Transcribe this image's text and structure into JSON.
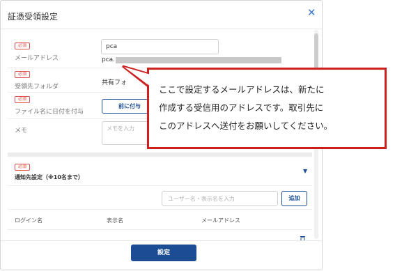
{
  "dialog": {
    "title": "証憑受領設定"
  },
  "email": {
    "required": "必須",
    "label": "メールアドレス",
    "value": "pca",
    "address_prefix": "pca."
  },
  "folder": {
    "required": "必須",
    "label": "受領先フォルダ",
    "value": "共有フォ"
  },
  "filename_date": {
    "required": "必須",
    "label": "ファイル名に日付を付与",
    "option": "前に付与"
  },
  "memo": {
    "label": "メモ",
    "placeholder": "メモを入力"
  },
  "notify": {
    "required": "必須",
    "title": "通知先設定（※10名まで）",
    "search_placeholder": "ユーザー名・表示名を入力",
    "add_button": "追加",
    "columns": [
      "ログイン名",
      "表示名",
      "メールアドレス"
    ]
  },
  "footer": {
    "submit": "設定"
  },
  "callout": {
    "lines": [
      "ここで設定するメールアドレスは、新たに",
      "作成する受信用のアドレスです。取引先に",
      "このアドレスへ送付をお願いしてください。"
    ],
    "border_color": "#cc1f1f"
  },
  "colors": {
    "primary": "#1c4d94",
    "required": "#e05050"
  }
}
